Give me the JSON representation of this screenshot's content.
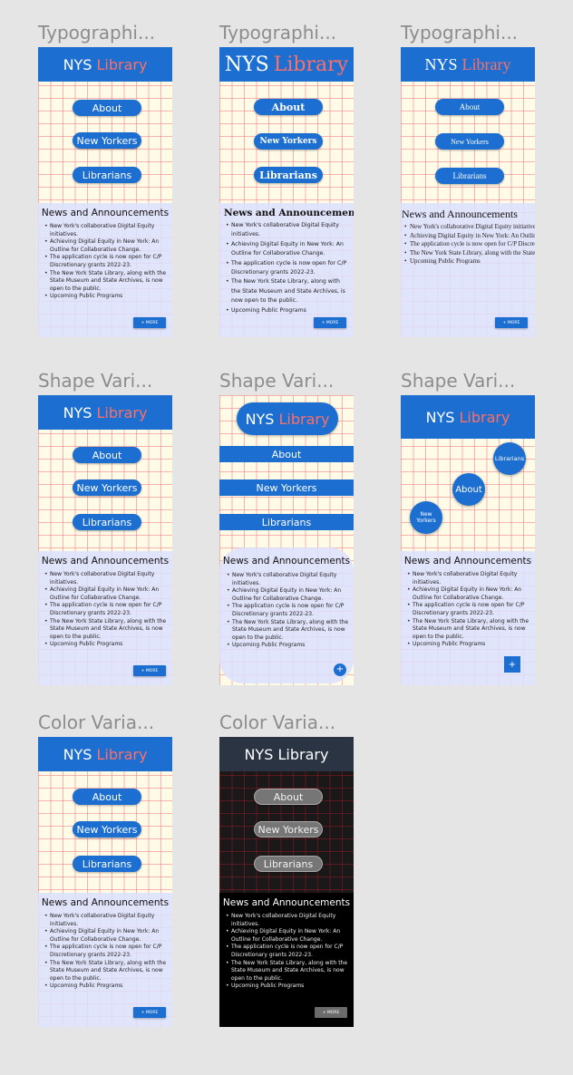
{
  "frame_titles": {
    "typo1": "Typographi...",
    "typo2": "Typographi...",
    "typo3": "Typographi...",
    "shape1": "Shape Vari...",
    "shape2": "Shape Vari...",
    "shape3": "Shape Vari...",
    "color1": "Color Varia...",
    "color2": "Color Varia..."
  },
  "app": {
    "brand_nys": "NYS",
    "brand_library": "Library",
    "brand_full": "NYS Library"
  },
  "nav": {
    "about": "About",
    "new_yorkers": "New Yorkers",
    "new_yorkers_short_1": "New",
    "new_yorkers_short_2": "Yorkers",
    "librarians": "Librarians"
  },
  "news": {
    "title": "News and Announcements",
    "items": [
      "New York's collaborative Digital Equity initiatives.",
      "Achieving Digital Equity in New York: An Outline for Collaborative Change.",
      "The application cycle is now open for C/P Discretionary grants 2022-23.",
      "The New York State Library, along with the State Museum and State Archives, is now open to the public.",
      "Upcoming Public Programs"
    ],
    "more_label": "+ MORE",
    "plus_label": "+"
  },
  "colors": {
    "brand_blue": "#1c6fd0",
    "accent_coral": "#ff6f66",
    "news_bg": "#dce0ff",
    "dark_bg": "#1b1819",
    "grid_line": "#f07882"
  }
}
